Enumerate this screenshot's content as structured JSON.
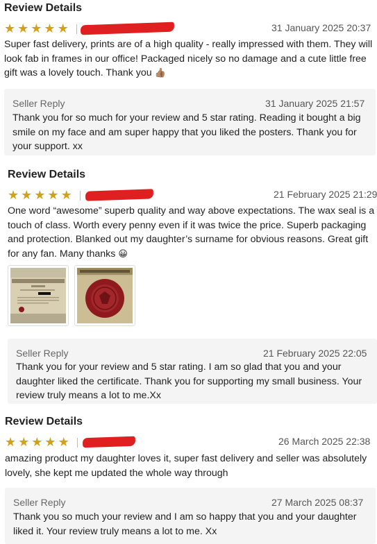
{
  "colors": {
    "star": "#d4a017",
    "redaction": "#e02020",
    "reply_bg": "#f4f4f4"
  },
  "reviews": [
    {
      "title": "Review Details",
      "rating": 5,
      "date": "31 January 2025 20:37",
      "text": "Super fast delivery, prints are of a high quality - really impressed with them. They will look fab in frames in our office! Packaged nicely so no damage and a cute little free gift was a lovely touch. Thank you",
      "emoji": "👍🏽",
      "reply": {
        "label": "Seller Reply",
        "date": "31 January 2025 21:57",
        "text": "Thank you for so much for your review and 5 star rating. Reading it bought a big smile on my face and am super happy that you liked the posters. Thank you for your support. xx"
      }
    },
    {
      "title": "Review Details",
      "rating": 5,
      "date": "21 February 2025 21:29",
      "text": "One word “awesome” superb quality and way above expectations. The wax seal is a touch of class. Worth every penny even if it was twice the price. Superb packaging and protection. Blanked out my daughter’s surname for obvious reasons. Great gift for any fan. Many thanks",
      "emoji": "😀",
      "photos": [
        "certificate-photo",
        "wax-seal-photo"
      ],
      "reply": {
        "label": "Seller Reply",
        "date": "21 February 2025 22:05",
        "text": "Thank you for your review and 5 star rating. I am so glad that you and your daughter liked the certificate. Thank you for supporting my small business. Your review truly means a lot to me.Xx"
      }
    },
    {
      "title": "Review Details",
      "rating": 5,
      "date": "26 March 2025 22:38",
      "text": "amazing product my daughter loves it, super fast delivery and seller was absolutely lovely, she kept me updated the whole way through",
      "reply": {
        "label": "Seller Reply",
        "date": "27 March 2025 08:37",
        "text": "Thank you so much your review and I am so happy that you and your daughter liked it. Your review truly means a lot to me. Xx"
      }
    }
  ]
}
